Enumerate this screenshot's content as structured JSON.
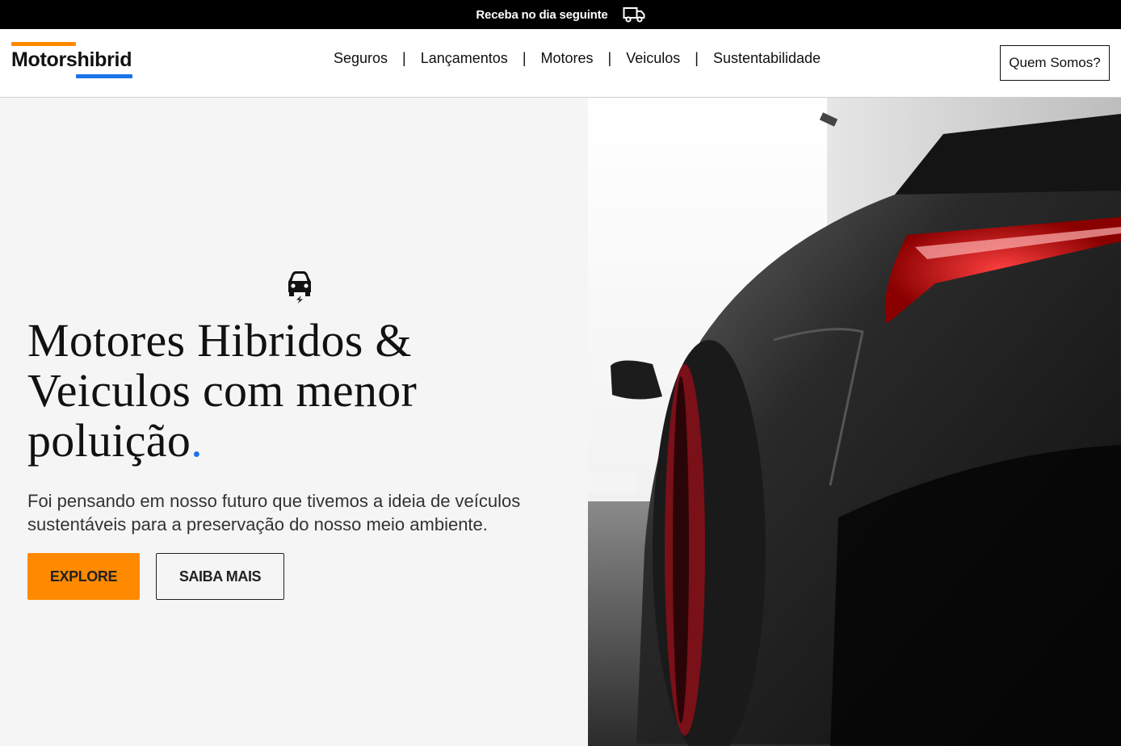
{
  "topbar": {
    "text": "Receba no dia seguinte",
    "icon": "truck-icon"
  },
  "header": {
    "logo_text": "Motorshibrid",
    "nav": [
      {
        "label": "Seguros"
      },
      {
        "label": "Lançamentos"
      },
      {
        "label": "Motores"
      },
      {
        "label": "Veiculos"
      },
      {
        "label": "Sustentabilidade"
      }
    ],
    "separator": "|",
    "about_button": "Quem Somos?"
  },
  "hero": {
    "icon": "electric-car-icon",
    "title": "Motores Hibridos & Veiculos com menor poluição",
    "title_dot": ".",
    "subtitle": "Foi pensando em nosso futuro que tivemos a ideia de veículos sustentáveis para a preservação do nosso meio ambiente.",
    "explore_button": "EXPLORE",
    "more_button": "SAIBA MAIS",
    "image": "sports-car-photo"
  },
  "colors": {
    "accent_orange": "#ff8a00",
    "accent_blue": "#1a73e8",
    "topbar_bg": "#000000",
    "hero_bg": "#f5f5f5"
  }
}
